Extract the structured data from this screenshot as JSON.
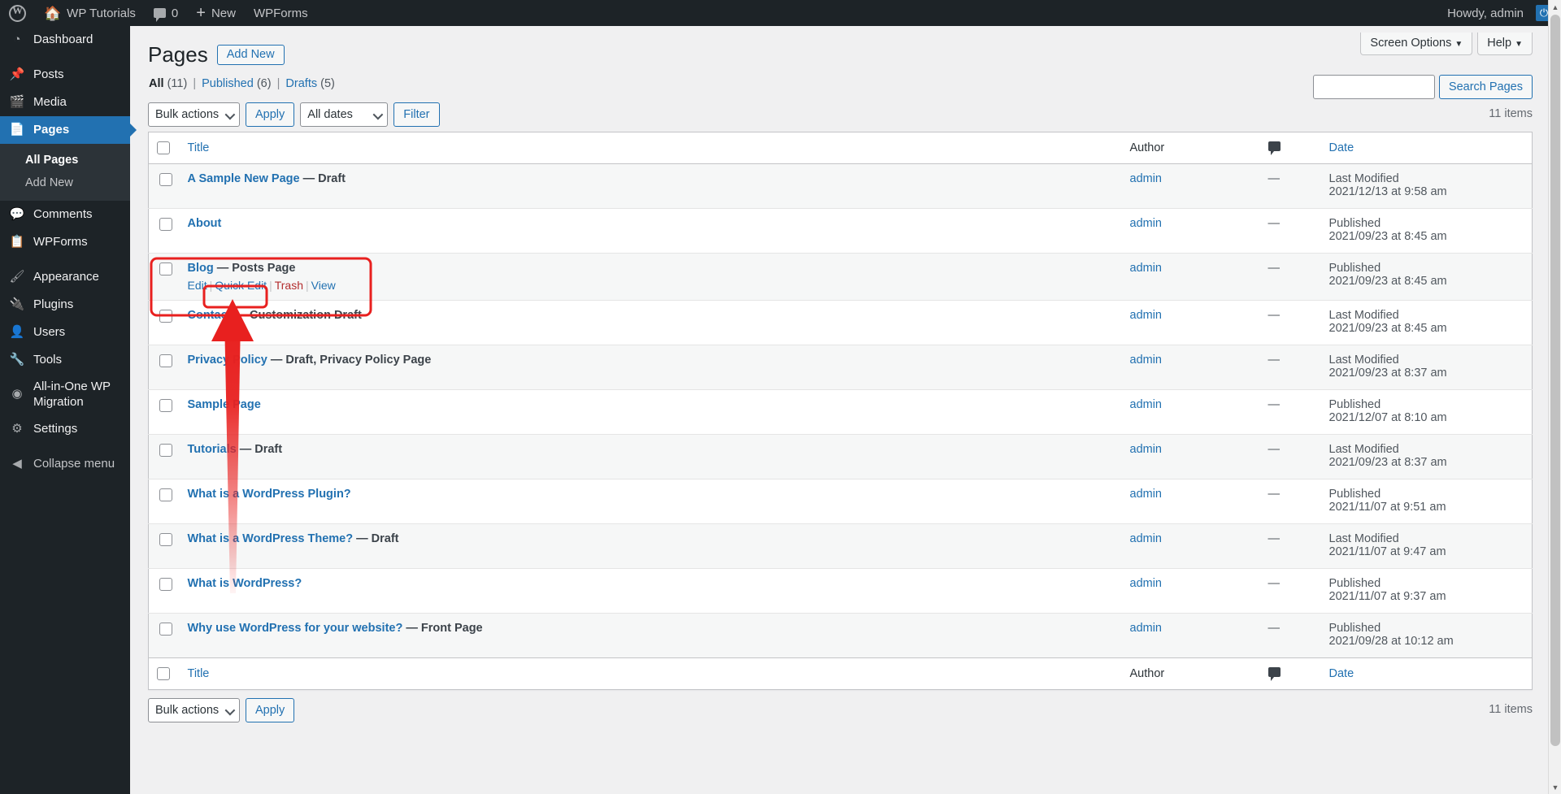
{
  "adminbar": {
    "logo_icon": "wordpress-logo-icon",
    "site_name": "WP Tutorials",
    "home_icon": "home-icon",
    "comments_icon": "comment-bubble-icon",
    "comments_count": "0",
    "new_icon": "plus-icon",
    "new_label": "New",
    "wpforms_label": "WPForms",
    "howdy": "Howdy, admin",
    "avatar_icon": "user-avatar-icon"
  },
  "sidebar": {
    "items": [
      {
        "label": "Dashboard",
        "icon": "dashboard-icon",
        "current": false
      },
      {
        "label": "Posts",
        "icon": "pin-icon",
        "current": false
      },
      {
        "label": "Media",
        "icon": "media-icon",
        "current": false
      },
      {
        "label": "Pages",
        "icon": "pages-icon",
        "current": true
      },
      {
        "label": "Comments",
        "icon": "comment-bubble-icon",
        "current": false
      },
      {
        "label": "WPForms",
        "icon": "wpforms-icon",
        "current": false
      },
      {
        "label": "Appearance",
        "icon": "paintbrush-icon",
        "current": false
      },
      {
        "label": "Plugins",
        "icon": "plug-icon",
        "current": false
      },
      {
        "label": "Users",
        "icon": "user-icon",
        "current": false
      },
      {
        "label": "Tools",
        "icon": "wrench-icon",
        "current": false
      },
      {
        "label": "All-in-One WP Migration",
        "icon": "migration-icon",
        "current": false
      },
      {
        "label": "Settings",
        "icon": "settings-sliders-icon",
        "current": false
      }
    ],
    "submenu": [
      {
        "label": "All Pages",
        "current": true
      },
      {
        "label": "Add New",
        "current": false
      }
    ],
    "collapse": {
      "label": "Collapse menu",
      "icon": "collapse-arrow-icon"
    }
  },
  "screen_meta": {
    "screen_options": "Screen Options",
    "help": "Help",
    "caret": "▼"
  },
  "header": {
    "title": "Pages",
    "add_new": "Add New"
  },
  "views": {
    "all_label": "All",
    "all_count": "(11)",
    "published_label": "Published",
    "published_count": "(6)",
    "drafts_label": "Drafts",
    "drafts_count": "(5)",
    "separator": "|"
  },
  "search": {
    "value": "",
    "placeholder": "",
    "button": "Search Pages"
  },
  "tablenav_top": {
    "bulk_actions": "Bulk actions",
    "apply": "Apply",
    "all_dates": "All dates",
    "filter": "Filter",
    "displaying": "11 items"
  },
  "tablenav_bottom": {
    "bulk_actions": "Bulk actions",
    "apply": "Apply",
    "displaying": "11 items"
  },
  "table": {
    "columns": {
      "cb": "select-all-checkbox",
      "title": "Title",
      "author": "Author",
      "comments": "comment-bubble-icon",
      "date": "Date"
    },
    "rows": [
      {
        "title": "A Sample New Page",
        "state": "— Draft",
        "author": "admin",
        "comments": "—",
        "date_status": "Last Modified",
        "date_value": "2021/12/13 at 9:58 am",
        "highlighted": false,
        "show_actions": false
      },
      {
        "title": "About",
        "state": "",
        "author": "admin",
        "comments": "—",
        "date_status": "Published",
        "date_value": "2021/09/23 at 8:45 am",
        "highlighted": false,
        "show_actions": false
      },
      {
        "title": "Blog",
        "state": "— Posts Page",
        "author": "admin",
        "comments": "—",
        "date_status": "Published",
        "date_value": "2021/09/23 at 8:45 am",
        "highlighted": true,
        "show_actions": true,
        "actions": {
          "edit": "Edit",
          "quick_edit": "Quick Edit",
          "trash": "Trash",
          "view": "View"
        }
      },
      {
        "title": "Contact",
        "state": "— Customization Draft",
        "author": "admin",
        "comments": "—",
        "date_status": "Last Modified",
        "date_value": "2021/09/23 at 8:45 am",
        "highlighted": false,
        "show_actions": false
      },
      {
        "title": "Privacy Policy",
        "state": "— Draft, Privacy Policy Page",
        "author": "admin",
        "comments": "—",
        "date_status": "Last Modified",
        "date_value": "2021/09/23 at 8:37 am",
        "highlighted": false,
        "show_actions": false
      },
      {
        "title": "Sample Page",
        "state": "",
        "author": "admin",
        "comments": "—",
        "date_status": "Published",
        "date_value": "2021/12/07 at 8:10 am",
        "highlighted": false,
        "show_actions": false
      },
      {
        "title": "Tutorials",
        "state": "— Draft",
        "author": "admin",
        "comments": "—",
        "date_status": "Last Modified",
        "date_value": "2021/09/23 at 8:37 am",
        "highlighted": false,
        "show_actions": false
      },
      {
        "title": "What is a WordPress Plugin?",
        "state": "",
        "author": "admin",
        "comments": "—",
        "date_status": "Published",
        "date_value": "2021/11/07 at 9:51 am",
        "highlighted": false,
        "show_actions": false
      },
      {
        "title": "What is a WordPress Theme?",
        "state": "— Draft",
        "author": "admin",
        "comments": "—",
        "date_status": "Last Modified",
        "date_value": "2021/11/07 at 9:47 am",
        "highlighted": false,
        "show_actions": false
      },
      {
        "title": "What is WordPress?",
        "state": "",
        "author": "admin",
        "comments": "—",
        "date_status": "Published",
        "date_value": "2021/11/07 at 9:37 am",
        "highlighted": false,
        "show_actions": false
      },
      {
        "title": "Why use WordPress for your website?",
        "state": "— Front Page",
        "author": "admin",
        "comments": "—",
        "date_status": "Published",
        "date_value": "2021/09/28 at 10:12 am",
        "highlighted": false,
        "show_actions": false
      }
    ]
  },
  "annotations": {
    "color": "#e8201f",
    "row_box": "highlight-box-blog-row",
    "button_box": "highlight-box-quick-edit",
    "arrow": "red-arrow-pointing-to-quick-edit"
  },
  "colors": {
    "admin_blue": "#2271b1",
    "sidebar_dark": "#1d2327",
    "link": "#2271b1",
    "annotation_red": "#e8201f"
  },
  "scrollbar": {
    "up_arrow": "▲",
    "down_arrow": "▼"
  }
}
